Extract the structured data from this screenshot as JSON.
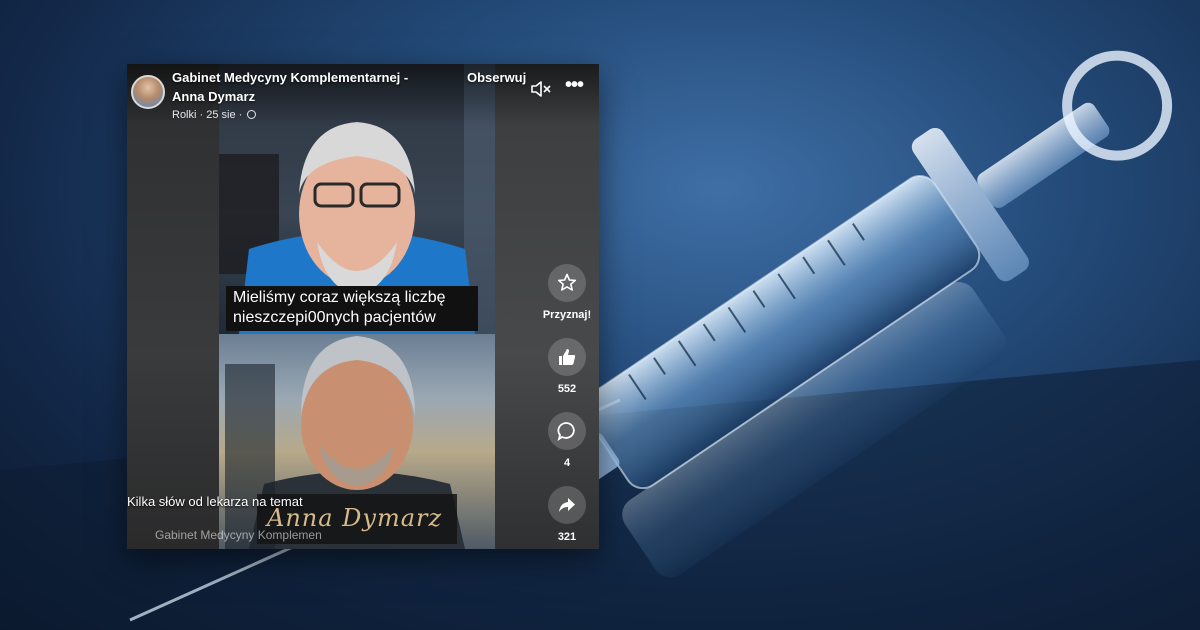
{
  "post": {
    "page_name_line1": "Gabinet Medycyny Komplementarnej -",
    "page_name_line2": "Anna Dymarz",
    "follow_label": "Obserwuj",
    "meta_text": "Rolki · 25 sie ·",
    "icons": {
      "avatar": "avatar",
      "audience": "globe-icon",
      "mute": "speaker-muted-icon",
      "more": "more-icon"
    }
  },
  "video": {
    "subtitle_line1": "Mieliśmy coraz większą liczbę",
    "subtitle_line2": "nieszczepi00nych pacjentów",
    "signature_text": "Anna Dymarz",
    "watermark_text": "Gabinet Medycyny Komplemen"
  },
  "caption": "Kilka słów od lekarza na temat",
  "actions": [
    {
      "name": "award",
      "icon": "star-award-icon",
      "label": "Przyznaj!"
    },
    {
      "name": "like",
      "icon": "thumbs-up-icon",
      "label": "552"
    },
    {
      "name": "comment",
      "icon": "comment-icon",
      "label": "4"
    },
    {
      "name": "share",
      "icon": "share-icon",
      "label": "321"
    }
  ],
  "colors": {
    "background": "#234a78",
    "card": "#3a3b3c",
    "text": "#ffffff"
  }
}
